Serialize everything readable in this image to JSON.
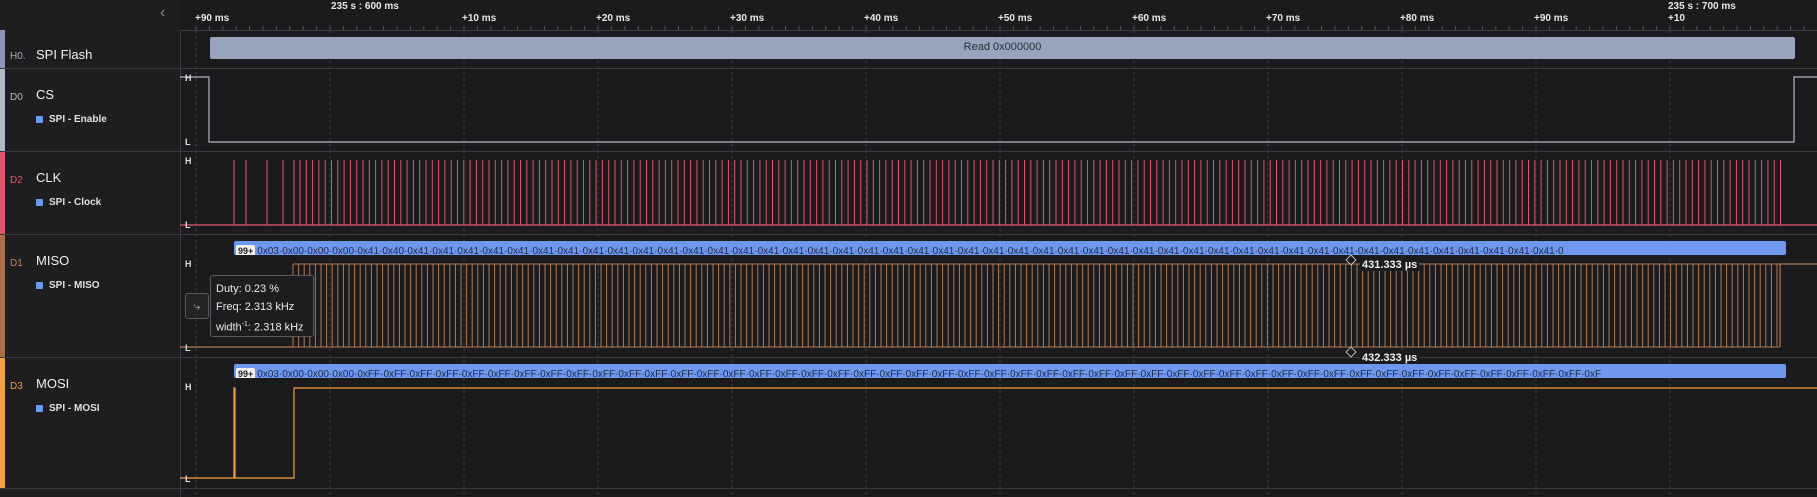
{
  "ruler": {
    "abs_labels": [
      "235 s : 600 ms",
      "235 s : 700 ms"
    ],
    "ticks": [
      "+90 ms",
      "+10 ms",
      "+20 ms",
      "+30 ms",
      "+40 ms",
      "+50 ms",
      "+60 ms",
      "+70 ms",
      "+80 ms",
      "+90 ms",
      "+10"
    ]
  },
  "analyzer": {
    "id": "H0.",
    "name": "SPI Flash",
    "frame_label": "Read 0x000000"
  },
  "channels": {
    "cs": {
      "id": "D0",
      "name": "CS",
      "sub": "SPI - Enable",
      "high": "H",
      "low": "L",
      "color": "#b0b8c8"
    },
    "clk": {
      "id": "D2",
      "name": "CLK",
      "sub": "SPI - Clock",
      "high": "H",
      "low": "L",
      "color": "#e0566f"
    },
    "miso": {
      "id": "D1",
      "name": "MISO",
      "sub": "SPI - MISO",
      "high": "H",
      "low": "L",
      "color": "#b07850"
    },
    "mosi": {
      "id": "D3",
      "name": "MOSI",
      "sub": "SPI - MOSI",
      "high": "H",
      "low": "L",
      "color": "#f0a040"
    }
  },
  "miso_bytes": {
    "badge": "99+",
    "text": "0x03·0x00·0x00·0x00·0x41·0x40·0x41·0x41·0x41·0x41·0x41·0x41·0x41·0x41·0x41·0x41·0x41·0x41·0x41·0x41·0x41·0x41·0x41·0x41·0x41·0x41·0x41·0x41·0x41·0x41·0x41·0x41·0x41·0x41·0x41·0x41·0x41·0x41·0x41·0x41·0x41·0x41·0x41·0x41·0x41·0x41·0x41·0x41·0x41·0x41·0x41·0x41·0"
  },
  "mosi_bytes": {
    "badge": "99+",
    "text": "0x03·0x00·0x00·0x00·0xFF·0xFF·0xFF·0xFF·0xFF·0xFF·0xFF·0xFF·0xFF·0xFF·0xFF·0xFF·0xFF·0xFF·0xFF·0xFF·0xFF·0xFF·0xFF·0xFF·0xFF·0xFF·0xFF·0xFF·0xFF·0xFF·0xFF·0xFF·0xFF·0xFF·0xFF·0xFF·0xFF·0xFF·0xFF·0xFF·0xFF·0xFF·0xFF·0xFF·0xFF·0xFF·0xFF·0xFF·0xFF·0xFF·0xFF·0xF"
  },
  "tooltip": {
    "duty": "Duty: 0.23 %",
    "freq": "Freq: 2.313 kHz",
    "width_prefix": "width",
    "width_sup": "-1",
    "width_value": ": 2.318 kHz"
  },
  "measurements": {
    "upper": "431.333 µs",
    "lower": "432.333 µs"
  },
  "icons": {
    "collapse": "chevron-left-icon",
    "measure": "measure-tool-icon"
  }
}
